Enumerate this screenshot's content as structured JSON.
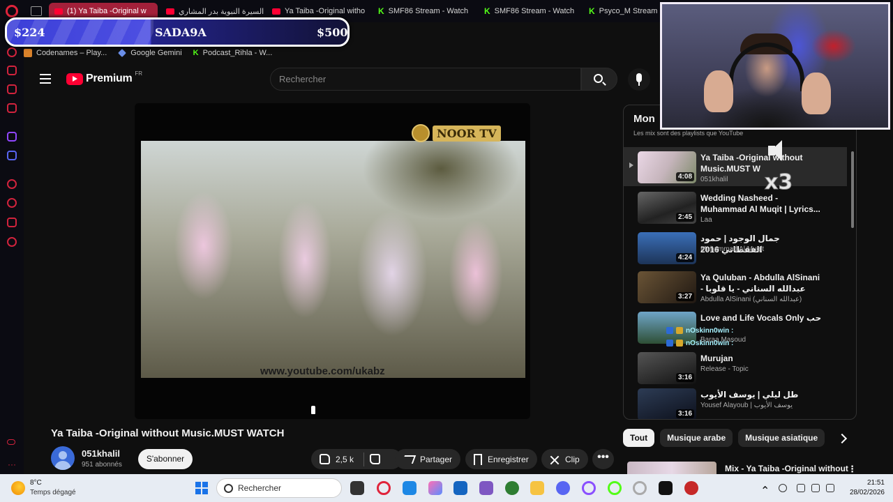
{
  "browser": {
    "tabs": [
      {
        "label": "(1) Ya Taiba -Original w",
        "kind": "youtube",
        "active": true
      },
      {
        "label": "السيرة النبوية بدر المشاري",
        "kind": "youtube",
        "active": false
      },
      {
        "label": "Ya Taiba -Original witho",
        "kind": "youtube",
        "active": false
      },
      {
        "label": "SMF86 Stream - Watch",
        "kind": "kick",
        "active": false
      },
      {
        "label": "SMF86 Stream - Watch",
        "kind": "kick",
        "active": false
      },
      {
        "label": "Psyco_M Stream -",
        "kind": "kick",
        "active": false
      }
    ],
    "bookmarks": [
      "Codenames – Play...",
      "Google Gemini",
      "Podcast_Rihla - W..."
    ]
  },
  "goal_bar": {
    "left": "$224",
    "center": "SADA9A",
    "right": "$500",
    "progress_fraction": 0.45
  },
  "youtube": {
    "logo_text": "Premium",
    "logo_region": "FR",
    "search_placeholder": "Rechercher",
    "video": {
      "channel_logo": "NOOR TV",
      "watermark": "www.youtube.com/ukabz",
      "title": "Ya Taiba -Original without Music.MUST WATCH",
      "channel": "051khalil",
      "subscribers": "951 abonnés",
      "subscribe_label": "S'abonner",
      "likes": "2,5 k",
      "share_label": "Partager",
      "save_label": "Enregistrer",
      "clip_label": "Clip",
      "more_label": "•••"
    },
    "playlist": {
      "title": "Mon",
      "subtitle": "Les mix sont des playlists que YouTube",
      "items": [
        {
          "title": "Ya Taiba -Original without Music.MUST W",
          "channel": "051khalil",
          "duration": "4:08",
          "current": true
        },
        {
          "title": "Wedding Nasheed - Muhammad Al Muqit | Lyrics...",
          "channel": "Laa",
          "duration": "2:45"
        },
        {
          "title": "جمال الوجود | حمود الفقطاني 2016",
          "channel": "Muhammad Al Muqit",
          "duration": "4:24"
        },
        {
          "title": "Ya Quluban - Abdulla AlSinani - عبدالله السناني - يا قلوبا",
          "channel": "Abdulla AlSinani (عبدالله السناني)",
          "duration": "3:27"
        },
        {
          "title": "Love and Life Vocals Only حب",
          "channel": "Baraa Masoud",
          "duration": ""
        },
        {
          "title": "Murujan",
          "channel": "Release - Topic",
          "duration": "3:16"
        },
        {
          "title": "طل ليلي | يوسف الأيوب",
          "channel": "Yousef Alayoub | يوسف الأيوب",
          "duration": "3:16"
        }
      ]
    },
    "chips": [
      "Tout",
      "Musique arabe",
      "Musique asiatique"
    ],
    "next_mix_title": "Mix - Ya Taiba -Original without"
  },
  "overlay": {
    "volume_multiplier": "x3",
    "chat": [
      {
        "user": "nOskinn0win :",
        "text": "",
        "color": "#a7f2ff"
      },
      {
        "user": "nOskinn0win :",
        "text": "",
        "color": "#a7f2ff"
      }
    ]
  },
  "taskbar": {
    "temperature": "8°C",
    "weather": "Temps dégagé",
    "search_placeholder": "Rechercher",
    "time": "21:51",
    "date": "28/02/2026"
  },
  "colors": {
    "youtube_red": "#ff0033",
    "opera_red": "#e0243b",
    "kick_green": "#53fc18",
    "goal_blue": "#3b3fd8"
  }
}
